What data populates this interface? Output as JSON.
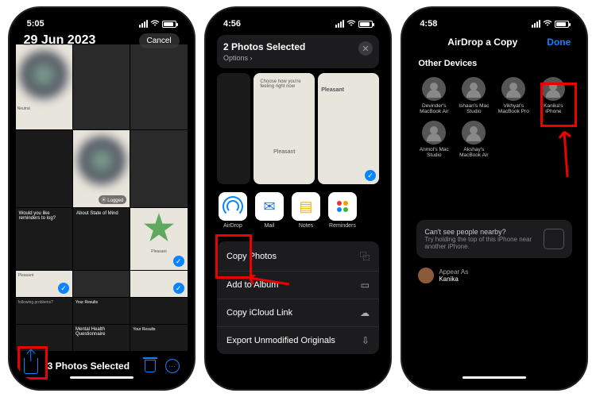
{
  "phone1": {
    "time": "5:05",
    "date": "29 Jun 2023",
    "cancel": "Cancel",
    "selected_count": "3 Photos Selected",
    "cells": {
      "neutral": "Neutral",
      "logged": "⦿ Logged",
      "pleasant": "Pleasant",
      "reminder_q": "Would you like reminders to log?",
      "state": "About State of Mind",
      "following": "following problems?",
      "results": "Your Results",
      "mhq": "Mental Health Questionnaire"
    }
  },
  "phone2": {
    "time": "4:56",
    "sheet_title": "2 Photos Selected",
    "options": "Options ›",
    "prev_choose": "Choose how you're feeling right now",
    "prev_pleasant": "Pleasant",
    "apps": {
      "airdrop": "AirDrop",
      "mail": "Mail",
      "notes": "Notes",
      "reminders": "Reminders"
    },
    "actions": {
      "copy": "Copy Photos",
      "album": "Add to Album",
      "icloud": "Copy iCloud Link",
      "export": "Export Unmodified Originals"
    }
  },
  "phone3": {
    "time": "4:58",
    "title": "AirDrop a Copy",
    "done": "Done",
    "section": "Other Devices",
    "devices": [
      "Devinder's MacBook Air",
      "Ishaan's Mac Studio",
      "Vikhyat's MacBook Pro",
      "Kanika's iPhone",
      "Anmol's Mac Studio",
      "Akshay's MacBook Air"
    ],
    "hint_title": "Can't see people nearby?",
    "hint_body": "Try holding the top of this iPhone near another iPhone.",
    "appear_label": "Appear As",
    "appear_name": "Kanika"
  }
}
